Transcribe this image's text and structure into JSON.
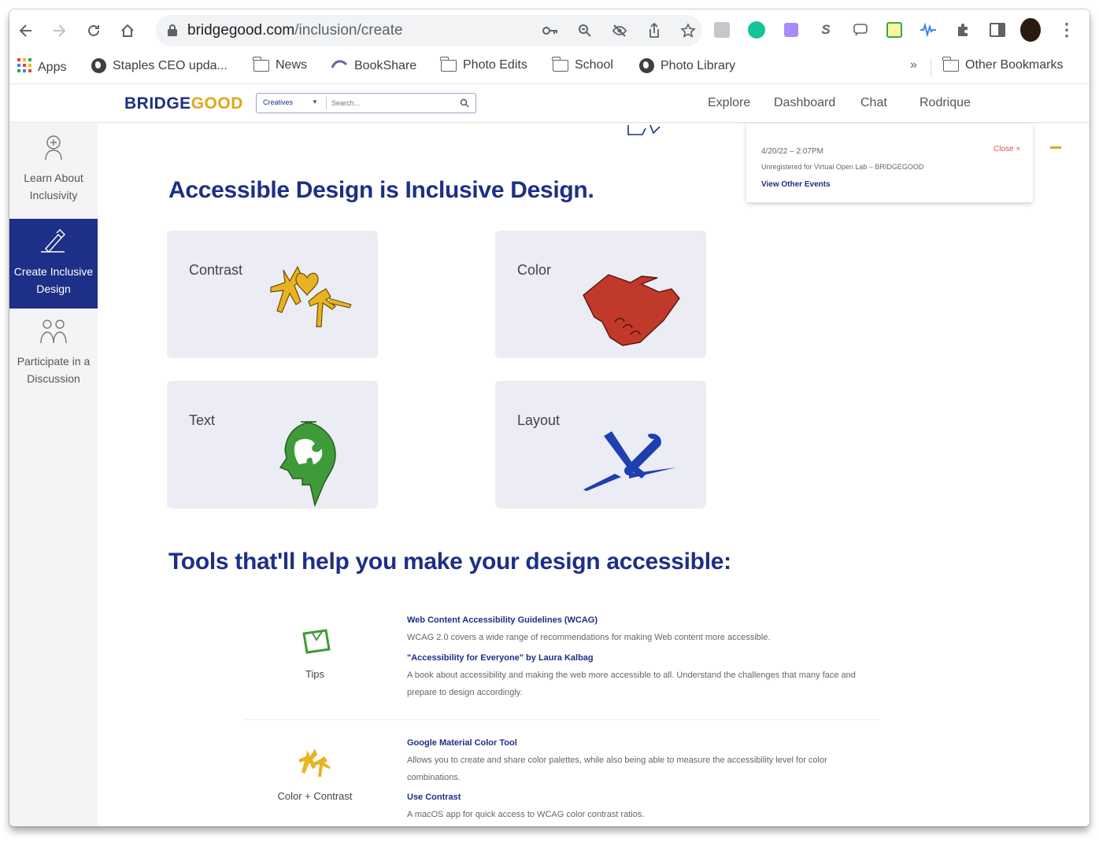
{
  "browser": {
    "url_host": "bridgegood.com",
    "url_path": "/inclusion/create",
    "bookmarks": [
      {
        "label": "Apps"
      },
      {
        "label": "Staples CEO upda..."
      },
      {
        "label": "News"
      },
      {
        "label": "BookShare"
      },
      {
        "label": "Photo Edits"
      },
      {
        "label": "School"
      },
      {
        "label": "Photo Library"
      }
    ],
    "overflow_label": "»",
    "other_bookmarks": "Other Bookmarks"
  },
  "site": {
    "logo_part1": "BRIDGE",
    "logo_part2": "GOOD",
    "search_category": "Creatives",
    "search_placeholder": "Search...",
    "nav": [
      "Explore",
      "Dashboard",
      "Chat",
      "Rodrique"
    ]
  },
  "sidebar": {
    "items": [
      {
        "line1": "Learn About",
        "line2": "Inclusivity"
      },
      {
        "line1": "Create Inclusive",
        "line2": "Design"
      },
      {
        "line1": "Participate in a",
        "line2": "Discussion"
      }
    ]
  },
  "notification": {
    "time": "4/20/22 – 2:07PM",
    "message": "Unregistered for Virtual Open Lab – BRIDGEGOOD",
    "link": "View Other Events",
    "close": "Close ×"
  },
  "main": {
    "heading": "Accessible Design is Inclusive Design.",
    "cards": [
      {
        "label": "Contrast"
      },
      {
        "label": "Color"
      },
      {
        "label": "Text"
      },
      {
        "label": "Layout"
      }
    ],
    "tools_heading": "Tools that'll help you make your design accessible:",
    "tool_groups": [
      {
        "label": "Tips",
        "items": [
          {
            "title": "Web Content Accessibility Guidelines (WCAG)",
            "desc": "WCAG 2.0 covers a wide range of recommendations for making Web content more accessible."
          },
          {
            "title": "\"Accessibility for Everyone\" by Laura Kalbag",
            "desc": "A book about accessibility and making the web more accessible to all. Understand the challenges that many face and prepare to design accordingly."
          }
        ]
      },
      {
        "label": "Color + Contrast",
        "items": [
          {
            "title": "Google Material Color Tool",
            "desc": "Allows you to create and share color palettes, while also being able to measure the accessibility level for color combinations."
          },
          {
            "title": "Use Contrast",
            "desc": "A macOS app for quick access to WCAG color contrast ratios."
          }
        ]
      }
    ]
  },
  "colors": {
    "brand_blue": "#1d2f86",
    "brand_gold": "#e0a619",
    "card_bg": "#ececf5",
    "color_card_red": "#c0392b",
    "text_card_green": "#3f9a3a",
    "layout_card_blue": "#1d3fb0"
  }
}
